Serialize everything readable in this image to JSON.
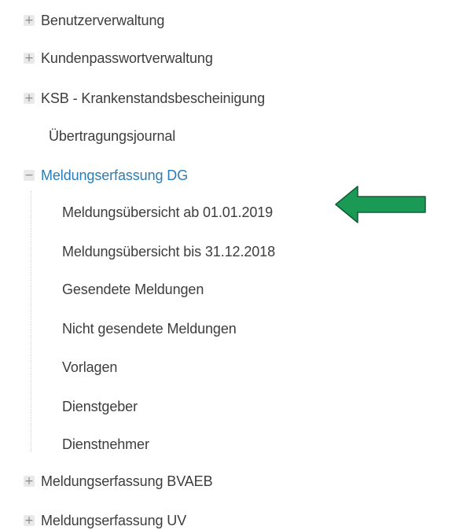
{
  "menu": {
    "items": [
      {
        "label": "Benutzerverwaltung",
        "toggle": "+"
      },
      {
        "label": "Kundenpasswortverwaltung",
        "toggle": "+"
      },
      {
        "label": "KSB - Krankenstandsbescheinigung",
        "toggle": "+"
      },
      {
        "label": "Übertragungsjournal",
        "toggle": ""
      },
      {
        "label": "Meldungserfassung DG",
        "toggle": "−"
      },
      {
        "label": "Meldungserfassung BVAEB",
        "toggle": "+"
      },
      {
        "label": "Meldungserfassung UV",
        "toggle": "+"
      }
    ],
    "subitems": [
      {
        "label": "Meldungsübersicht ab 01.01.2019"
      },
      {
        "label": "Meldungsübersicht bis 31.12.2018"
      },
      {
        "label": "Gesendete Meldungen"
      },
      {
        "label": "Nicht gesendete Meldungen"
      },
      {
        "label": "Vorlagen"
      },
      {
        "label": "Dienstgeber"
      },
      {
        "label": "Dienstnehmer"
      }
    ]
  },
  "colors": {
    "active": "#2a7db8",
    "text": "#3d3d3d",
    "arrow": "#1a9a55"
  },
  "icons": {
    "expand": "plus-icon",
    "collapse": "minus-icon",
    "pointer": "arrow-left-icon"
  }
}
